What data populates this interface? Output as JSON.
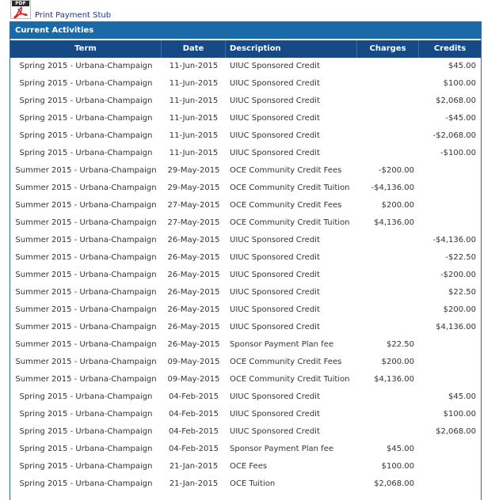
{
  "top": {
    "pdf_icon_text": "PDF",
    "print_link": "Print Payment Stub"
  },
  "panel": {
    "title": "Current Activities",
    "columns": {
      "term": "Term",
      "date": "Date",
      "description": "Description",
      "charges": "Charges",
      "credits": "Credits"
    },
    "rows": [
      {
        "term": "Spring 2015 - Urbana-Champaign",
        "date": "11-Jun-2015",
        "description": "UIUC Sponsored Credit",
        "charges": "",
        "credits": "$45.00"
      },
      {
        "term": "Spring 2015 - Urbana-Champaign",
        "date": "11-Jun-2015",
        "description": "UIUC Sponsored Credit",
        "charges": "",
        "credits": "$100.00"
      },
      {
        "term": "Spring 2015 - Urbana-Champaign",
        "date": "11-Jun-2015",
        "description": "UIUC Sponsored Credit",
        "charges": "",
        "credits": "$2,068.00"
      },
      {
        "term": "Spring 2015 - Urbana-Champaign",
        "date": "11-Jun-2015",
        "description": "UIUC Sponsored Credit",
        "charges": "",
        "credits": "-$45.00"
      },
      {
        "term": "Spring 2015 - Urbana-Champaign",
        "date": "11-Jun-2015",
        "description": "UIUC Sponsored Credit",
        "charges": "",
        "credits": "-$2,068.00"
      },
      {
        "term": "Spring 2015 - Urbana-Champaign",
        "date": "11-Jun-2015",
        "description": "UIUC Sponsored Credit",
        "charges": "",
        "credits": "-$100.00"
      },
      {
        "term": "Summer 2015 - Urbana-Champaign",
        "date": "29-May-2015",
        "description": "OCE Community Credit Fees",
        "charges": "-$200.00",
        "credits": ""
      },
      {
        "term": "Summer 2015 - Urbana-Champaign",
        "date": "29-May-2015",
        "description": "OCE Community Credit Tuition",
        "charges": "-$4,136.00",
        "credits": ""
      },
      {
        "term": "Summer 2015 - Urbana-Champaign",
        "date": "27-May-2015",
        "description": "OCE Community Credit Fees",
        "charges": "$200.00",
        "credits": ""
      },
      {
        "term": "Summer 2015 - Urbana-Champaign",
        "date": "27-May-2015",
        "description": "OCE Community Credit Tuition",
        "charges": "$4,136.00",
        "credits": ""
      },
      {
        "term": "Summer 2015 - Urbana-Champaign",
        "date": "26-May-2015",
        "description": "UIUC Sponsored Credit",
        "charges": "",
        "credits": "-$4,136.00"
      },
      {
        "term": "Summer 2015 - Urbana-Champaign",
        "date": "26-May-2015",
        "description": "UIUC Sponsored Credit",
        "charges": "",
        "credits": "-$22.50"
      },
      {
        "term": "Summer 2015 - Urbana-Champaign",
        "date": "26-May-2015",
        "description": "UIUC Sponsored Credit",
        "charges": "",
        "credits": "-$200.00"
      },
      {
        "term": "Summer 2015 - Urbana-Champaign",
        "date": "26-May-2015",
        "description": "UIUC Sponsored Credit",
        "charges": "",
        "credits": "$22.50"
      },
      {
        "term": "Summer 2015 - Urbana-Champaign",
        "date": "26-May-2015",
        "description": "UIUC Sponsored Credit",
        "charges": "",
        "credits": "$200.00"
      },
      {
        "term": "Summer 2015 - Urbana-Champaign",
        "date": "26-May-2015",
        "description": "UIUC Sponsored Credit",
        "charges": "",
        "credits": "$4,136.00"
      },
      {
        "term": "Summer 2015 - Urbana-Champaign",
        "date": "26-May-2015",
        "description": "Sponsor Payment Plan fee",
        "charges": "$22.50",
        "credits": ""
      },
      {
        "term": "Summer 2015 - Urbana-Champaign",
        "date": "09-May-2015",
        "description": "OCE Community Credit Fees",
        "charges": "$200.00",
        "credits": ""
      },
      {
        "term": "Summer 2015 - Urbana-Champaign",
        "date": "09-May-2015",
        "description": "OCE Community Credit Tuition",
        "charges": "$4,136.00",
        "credits": ""
      },
      {
        "term": "Spring 2015 - Urbana-Champaign",
        "date": "04-Feb-2015",
        "description": "UIUC Sponsored Credit",
        "charges": "",
        "credits": "$45.00"
      },
      {
        "term": "Spring 2015 - Urbana-Champaign",
        "date": "04-Feb-2015",
        "description": "UIUC Sponsored Credit",
        "charges": "",
        "credits": "$100.00"
      },
      {
        "term": "Spring 2015 - Urbana-Champaign",
        "date": "04-Feb-2015",
        "description": "UIUC Sponsored Credit",
        "charges": "",
        "credits": "$2,068.00"
      },
      {
        "term": "Spring 2015 - Urbana-Champaign",
        "date": "04-Feb-2015",
        "description": "Sponsor Payment Plan fee",
        "charges": "$45.00",
        "credits": ""
      },
      {
        "term": "Spring 2015 - Urbana-Champaign",
        "date": "21-Jan-2015",
        "description": "OCE Fees",
        "charges": "$100.00",
        "credits": ""
      },
      {
        "term": "Spring 2015 - Urbana-Champaign",
        "date": "21-Jan-2015",
        "description": "OCE Tuition",
        "charges": "$2,068.00",
        "credits": ""
      }
    ]
  },
  "colors": {
    "title_bar": "#1a6aa8",
    "header_bar": "#154a86",
    "link": "#1a3399",
    "pdf_icon_red": "#d9241f"
  },
  "icons": {
    "pdf": "pdf-file-icon"
  }
}
